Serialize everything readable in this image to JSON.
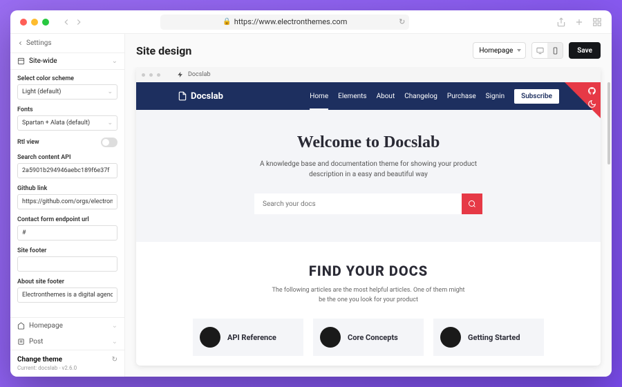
{
  "browser": {
    "url": "https://www.electronthemes.com"
  },
  "sidebar": {
    "back_label": "Settings",
    "sitewide_label": "Site-wide",
    "fields": {
      "color_scheme": {
        "label": "Select color scheme",
        "value": "Light (default)"
      },
      "fonts": {
        "label": "Fonts",
        "value": "Spartan + Alata (default)"
      },
      "rtl": {
        "label": "Rtl view"
      },
      "search_api": {
        "label": "Search content API",
        "value": "2a5901b294946aebc189f6e37f"
      },
      "github": {
        "label": "Github link",
        "value": "https://github.com/orgs/electronthe"
      },
      "contact": {
        "label": "Contact form endpoint url",
        "value": "#"
      },
      "footer": {
        "label": "Site footer",
        "value": ""
      },
      "about_footer": {
        "label": "About site footer",
        "value": "Electronthemes is a digital agency w"
      }
    },
    "nav": {
      "homepage": "Homepage",
      "post": "Post"
    },
    "footer": {
      "change": "Change theme",
      "current": "Current: docslab - v2.6.0"
    }
  },
  "topbar": {
    "title": "Site design",
    "page_select": "Homepage",
    "save": "Save"
  },
  "preview": {
    "tab_title": "Docslab",
    "logo": "Docslab",
    "nav": [
      "Home",
      "Elements",
      "About",
      "Changelog",
      "Purchase",
      "Signin"
    ],
    "subscribe": "Subscribe",
    "hero": {
      "title": "Welcome to Docslab",
      "subtitle": "A knowledge base and documentation theme for showing your product description in a easy and beautiful way",
      "search_placeholder": "Search your docs"
    },
    "section": {
      "title": "FIND YOUR DOCS",
      "subtitle": "The following articles are the most helpful articles. One of them might be the one you look for your product"
    },
    "cards": [
      "API Reference",
      "Core Concepts",
      "Getting Started"
    ]
  }
}
